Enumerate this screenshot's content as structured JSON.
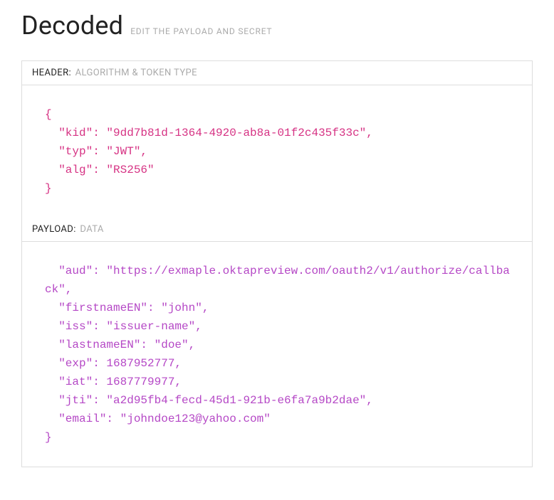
{
  "title": "Decoded",
  "subtitle": "EDIT THE PAYLOAD AND SECRET",
  "sections": {
    "header": {
      "label": "HEADER:",
      "sub": "ALGORITHM & TOKEN TYPE",
      "code_lines": [
        "{",
        "  \"kid\": \"9dd7b81d-1364-4920-ab8a-01f2c435f33c\",",
        "  \"typ\": \"JWT\",",
        "  \"alg\": \"RS256\"",
        "}"
      ]
    },
    "payload": {
      "label": "PAYLOAD:",
      "sub": "DATA",
      "code_lines": [
        "  \"aud\": \"https://exmaple.oktapreview.com/oauth2/v1/authorize/callback\",",
        "  \"firstnameEN\": \"john\",",
        "  \"iss\": \"issuer-name\",",
        "  \"lastnameEN\": \"doe\",",
        "  \"exp\": 1687952777,",
        "  \"iat\": 1687779977,",
        "  \"jti\": \"a2d95fb4-fecd-45d1-921b-e6fa7a9b2dae\",",
        "  \"email\": \"johndoe123@yahoo.com\"",
        "}"
      ]
    }
  }
}
